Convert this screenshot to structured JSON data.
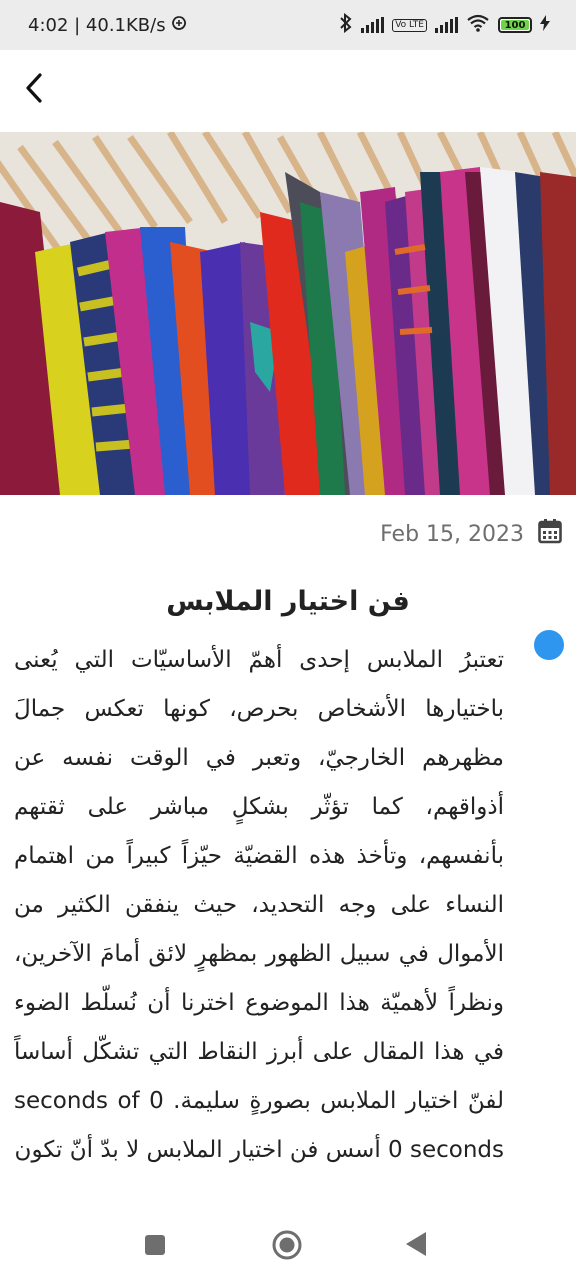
{
  "status_bar": {
    "time_speed": "4:02 | 40.1KB/s",
    "volte_label": "Vo LTE",
    "battery_level": "100",
    "icons": [
      "data-saver-icon",
      "bluetooth-icon",
      "signal-icon",
      "wifi-icon",
      "battery-icon",
      "charging-icon"
    ]
  },
  "app_bar": {
    "back_icon": "chevron-left-icon"
  },
  "article": {
    "image": "clothes-rack-photo",
    "date": "Feb 15, 2023",
    "date_icon": "calendar-icon",
    "title": "فن اختيار الملابس",
    "body": "تعتبرُ الملابس إحدى أهمّ الأساسيّات التي يُعنى باختيارها الأشخاص بحرص، كونها تعكس جمالَ مظهرهم الخارجيّ، وتعبر في الوقت نفسه عن أذواقهم، كما تؤثّر بشكلٍ مباشر على ثقتهم بأنفسهم، وتأخذ هذه القضيّة حيّزاً كبيراً من اهتمام النساء على وجه التحديد، حيث ينفقن الكثير من الأموال في سبيل الظهور بمظهرٍ لائق أمامَ الآخرين، ونظراً لأهميّة هذا الموضوع اخترنا أن نُسلّط الضوء في هذا المقال على أبرز النقاط التي تشكّل أساساً لفنّ اختيار الملابس بصورةٍ سليمة. 0 seconds of 0 seconds أسس فن اختيار الملابس لا بدّ أنّ تكون"
  },
  "colors": {
    "accent_dot": "#2f96f0",
    "battery_fill": "#6fd44a",
    "date_text": "#6e6e6e"
  },
  "nav_bar": {
    "icons": [
      "recent-apps-icon",
      "home-icon",
      "back-triangle-icon"
    ]
  }
}
